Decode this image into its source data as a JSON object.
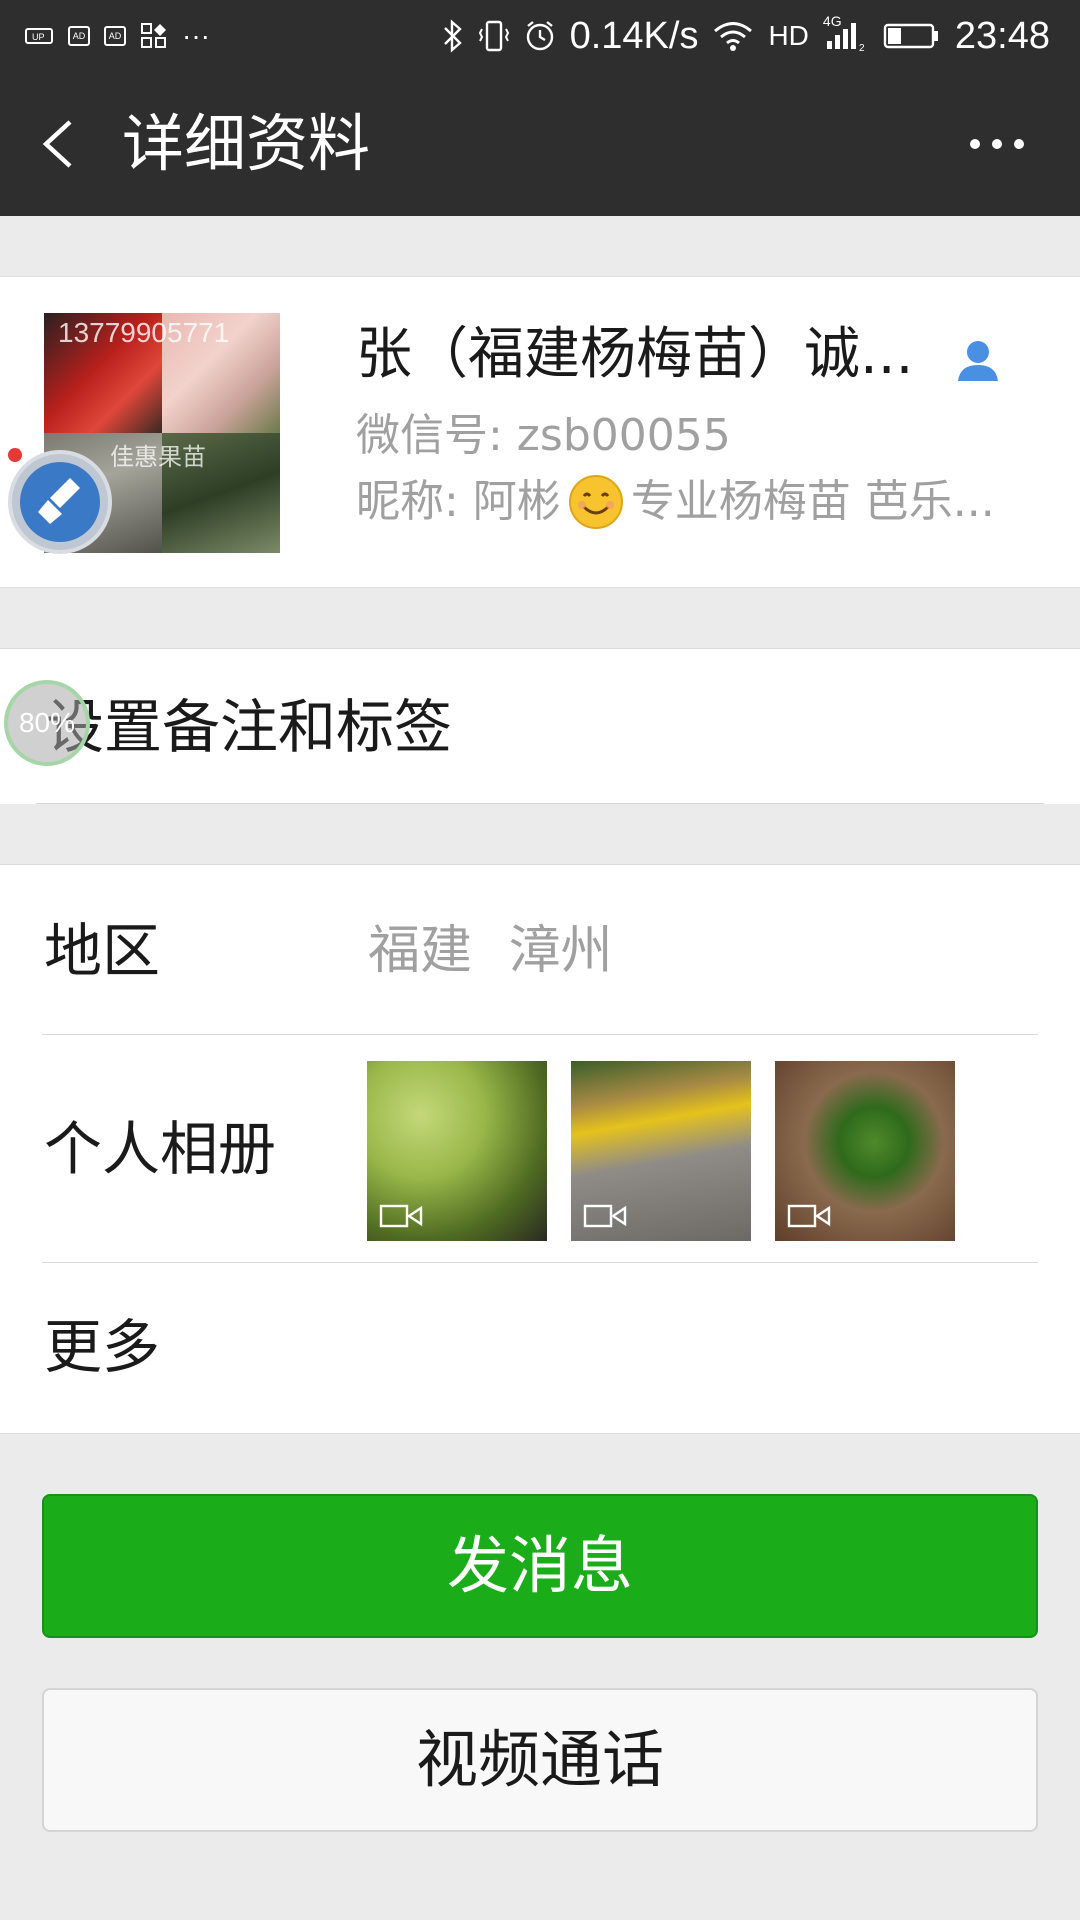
{
  "status_bar": {
    "net_speed": "0.14K/s",
    "hd": "HD",
    "network": "4G",
    "time": "23:48",
    "icons": [
      "notification-icon",
      "ad-icon",
      "ad-icon",
      "apps-icon",
      "more-notifications-icon",
      "bluetooth-icon",
      "vibrate-icon",
      "alarm-icon",
      "wifi-icon",
      "signal-icon",
      "battery-icon"
    ],
    "battery_level": 0.3
  },
  "navbar": {
    "title": "详细资料",
    "back_icon": "chevron-left-icon",
    "more_icon": "more-dots-icon"
  },
  "profile": {
    "name": "张（福建杨梅苗）诚...",
    "wechat_id": "微信号: zsb00055",
    "nickname_prefix": "昵称: 阿彬",
    "nickname_suffix": "专业杨梅苗 芭乐...",
    "avatar_text_1": "13779905771",
    "avatar_text_2": "佳惠果苗",
    "contact_icon": "contact-person-icon",
    "emoji": "smile-emoji-icon"
  },
  "overlays": {
    "progress_badge": "80%"
  },
  "remark": {
    "label": "设置备注和标签"
  },
  "info": {
    "region_label": "地区",
    "region_value": "福建  漳州",
    "album_label": "个人相册",
    "album_thumbnails": [
      "video-thumbnail-guava",
      "video-thumbnail-basket",
      "video-thumbnail-seedling"
    ],
    "more_label": "更多"
  },
  "buttons": {
    "send_message": "发消息",
    "video_call": "视频通话"
  },
  "colors": {
    "bar_bg": "#2e2e2e",
    "page_bg": "#ebebeb",
    "primary_green": "#1aad19",
    "secondary_text": "#a0a0a0",
    "contact_icon_blue": "#4a90e2"
  }
}
